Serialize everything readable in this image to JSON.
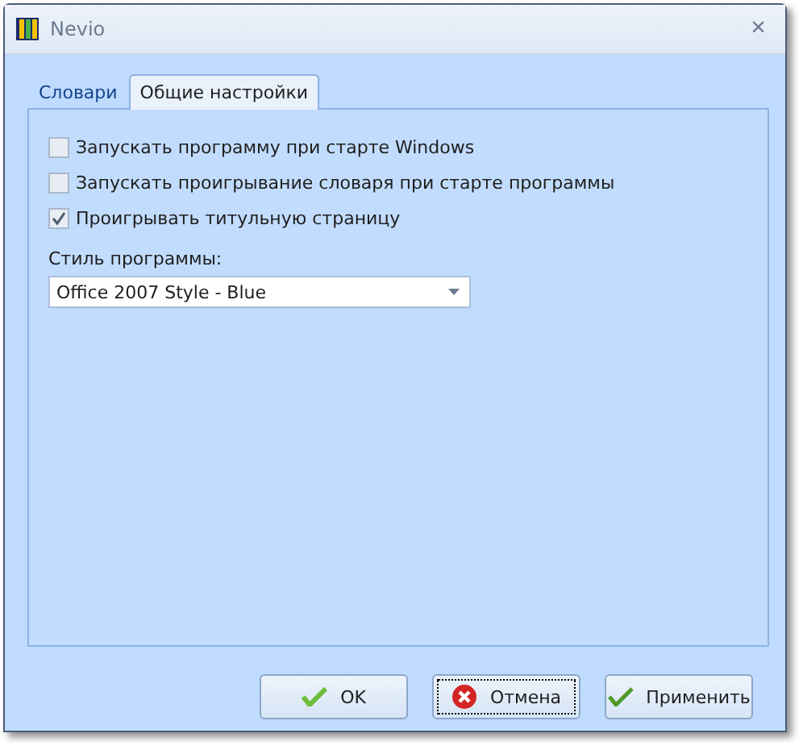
{
  "window": {
    "title": "Nevio",
    "close": "×"
  },
  "tabs": [
    {
      "label": "Словари",
      "selected": false
    },
    {
      "label": "Общие настройки",
      "selected": true
    }
  ],
  "options": [
    {
      "label": "Запускать программу при старте Windows",
      "checked": false
    },
    {
      "label": "Запускать проигрывание словаря при старте программы",
      "checked": false
    },
    {
      "label": "Проигрывать титульную страницу",
      "checked": true
    }
  ],
  "style_select": {
    "label": "Стиль программы:",
    "value": "Office 2007 Style - Blue"
  },
  "buttons": [
    {
      "label": "OK",
      "kind": "ok",
      "focused": false
    },
    {
      "label": "Отмена",
      "kind": "cancel",
      "focused": true
    },
    {
      "label": "Применить",
      "kind": "apply",
      "focused": false
    }
  ]
}
